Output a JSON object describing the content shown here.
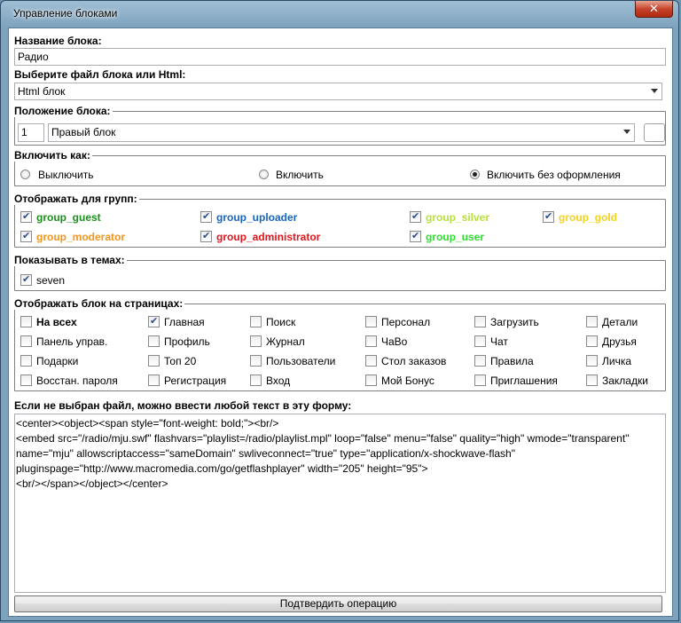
{
  "window": {
    "title": "Управление блоками",
    "close_glyph": "✕"
  },
  "block_name": {
    "label": "Название блока:",
    "value": "Радио"
  },
  "block_file": {
    "label": "Выберите файл блока или Html:",
    "selected": "Html блок"
  },
  "position": {
    "legend": "Положение блока:",
    "order": "1",
    "selected": "Правый блок"
  },
  "enable": {
    "legend": "Включить как:",
    "options": [
      {
        "label": "Выключить",
        "checked": false
      },
      {
        "label": "Включить",
        "checked": false
      },
      {
        "label": "Включить без оформления",
        "checked": true
      }
    ]
  },
  "groups": {
    "legend": "Отображать для групп:",
    "items": [
      {
        "label": "group_guest",
        "color": "#1a8f1a",
        "checked": true
      },
      {
        "label": "group_uploader",
        "color": "#1565c0",
        "checked": true
      },
      {
        "label": "group_silver",
        "color": "#b8e03a",
        "checked": true
      },
      {
        "label": "group_gold",
        "color": "#f2d21c",
        "checked": true
      },
      {
        "label": "group_moderator",
        "color": "#f0961c",
        "checked": true
      },
      {
        "label": "group_administrator",
        "color": "#e0161c",
        "checked": true
      },
      {
        "label": "group_user",
        "color": "#2ee02e",
        "checked": true
      }
    ]
  },
  "themes": {
    "legend": "Показывать в темах:",
    "items": [
      {
        "label": "seven",
        "checked": true
      }
    ]
  },
  "pages": {
    "legend": "Отображать блок на страницах:",
    "items": [
      {
        "label": "На всех",
        "checked": false
      },
      {
        "label": "Главная",
        "checked": true
      },
      {
        "label": "Поиск",
        "checked": false
      },
      {
        "label": "Персонал",
        "checked": false
      },
      {
        "label": "Загрузить",
        "checked": false
      },
      {
        "label": "Детали",
        "checked": false
      },
      {
        "label": "Панель управ.",
        "checked": false
      },
      {
        "label": "Профиль",
        "checked": false
      },
      {
        "label": "Журнал",
        "checked": false
      },
      {
        "label": "ЧаВо",
        "checked": false
      },
      {
        "label": "Чат",
        "checked": false
      },
      {
        "label": "Друзья",
        "checked": false
      },
      {
        "label": "Подарки",
        "checked": false
      },
      {
        "label": "Топ 20",
        "checked": false
      },
      {
        "label": "Пользователи",
        "checked": false
      },
      {
        "label": "Стол заказов",
        "checked": false
      },
      {
        "label": "Правила",
        "checked": false
      },
      {
        "label": "Личка",
        "checked": false
      },
      {
        "label": "Восстан. пароля",
        "checked": false
      },
      {
        "label": "Регистрация",
        "checked": false
      },
      {
        "label": "Вход",
        "checked": false
      },
      {
        "label": "Мой Бонус",
        "checked": false
      },
      {
        "label": "Приглашения",
        "checked": false
      },
      {
        "label": "Закладки",
        "checked": false
      }
    ]
  },
  "free_text": {
    "label": "Если не выбран файл, можно ввести любой текст в эту форму:",
    "value": "<center><object><span style=\"font-weight: bold;\"><br/>\n<embed src=\"/radio/mju.swf\" flashvars=\"playlist=/radio/playlist.mpl\" loop=\"false\" menu=\"false\" quality=\"high\" wmode=\"transparent\" name=\"mju\" allowscriptaccess=\"sameDomain\" swliveconnect=\"true\" type=\"application/x-shockwave-flash\" pluginspage=\"http://www.macromedia.com/go/getflashplayer\" width=\"205\" height=\"95\">\n<br/></span></object></center>"
  },
  "submit_label": "Подтвердить операцию"
}
